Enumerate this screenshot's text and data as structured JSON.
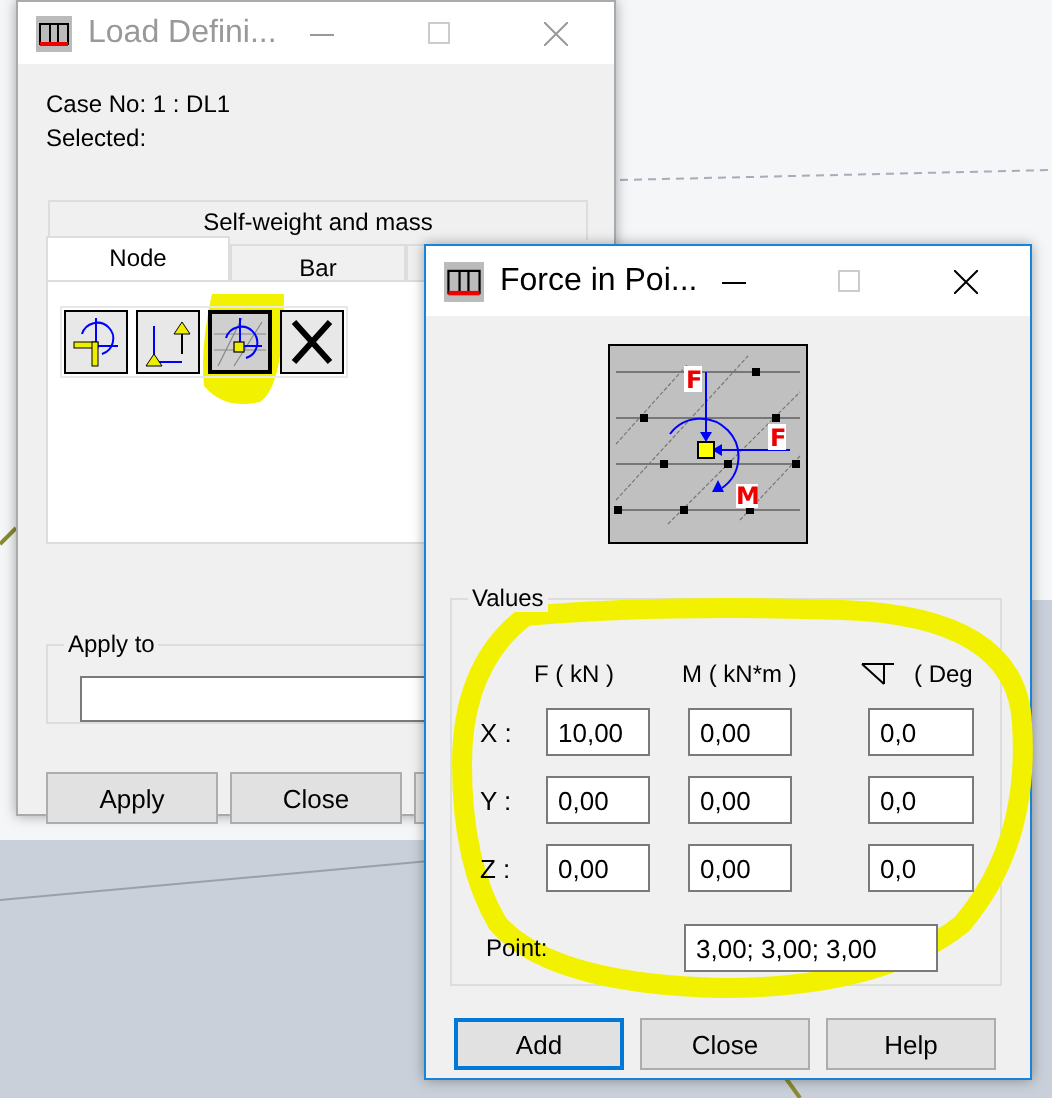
{
  "load_window": {
    "title": "Load Defini...",
    "case_no": "Case No: 1 : DL1",
    "selected_label": "Selected:",
    "group_title": "Self-weight and mass",
    "tabs": [
      {
        "label": "Node",
        "selected": true
      },
      {
        "label": "Bar",
        "selected": false
      },
      {
        "selected": false
      }
    ],
    "tools": [
      {
        "kind": "nodal-force",
        "selected": false
      },
      {
        "kind": "support",
        "selected": false
      },
      {
        "kind": "point-force",
        "selected": true
      },
      {
        "kind": "delete",
        "selected": false
      }
    ],
    "apply_to_label": "Apply to",
    "buttons": [
      "Apply",
      "Close"
    ]
  },
  "force_dialog": {
    "title": "Force in Poi...",
    "diagram_labels": [
      "F",
      "F",
      "M"
    ],
    "values_title": "Values",
    "columns": [
      {
        "kind": "text",
        "text": "F  ( kN )"
      },
      {
        "kind": "text",
        "text": "M ( kN*m )"
      },
      {
        "kind": "angle",
        "text": "( Deg"
      }
    ],
    "rows": [
      {
        "axis": "X :",
        "values": [
          "10,00",
          "0,00",
          "0,0"
        ]
      },
      {
        "axis": "Y :",
        "values": [
          "0,00",
          "0,00",
          "0,0"
        ]
      },
      {
        "axis": "Z :",
        "values": [
          "0,00",
          "0,00",
          "0,0"
        ]
      }
    ],
    "point_label": "Point:",
    "point_value": "3,00; 3,00; 3,00",
    "buttons": [
      {
        "label": "Add",
        "default": true
      },
      {
        "label": "Close",
        "default": false
      },
      {
        "label": "Help",
        "default": false
      }
    ]
  }
}
